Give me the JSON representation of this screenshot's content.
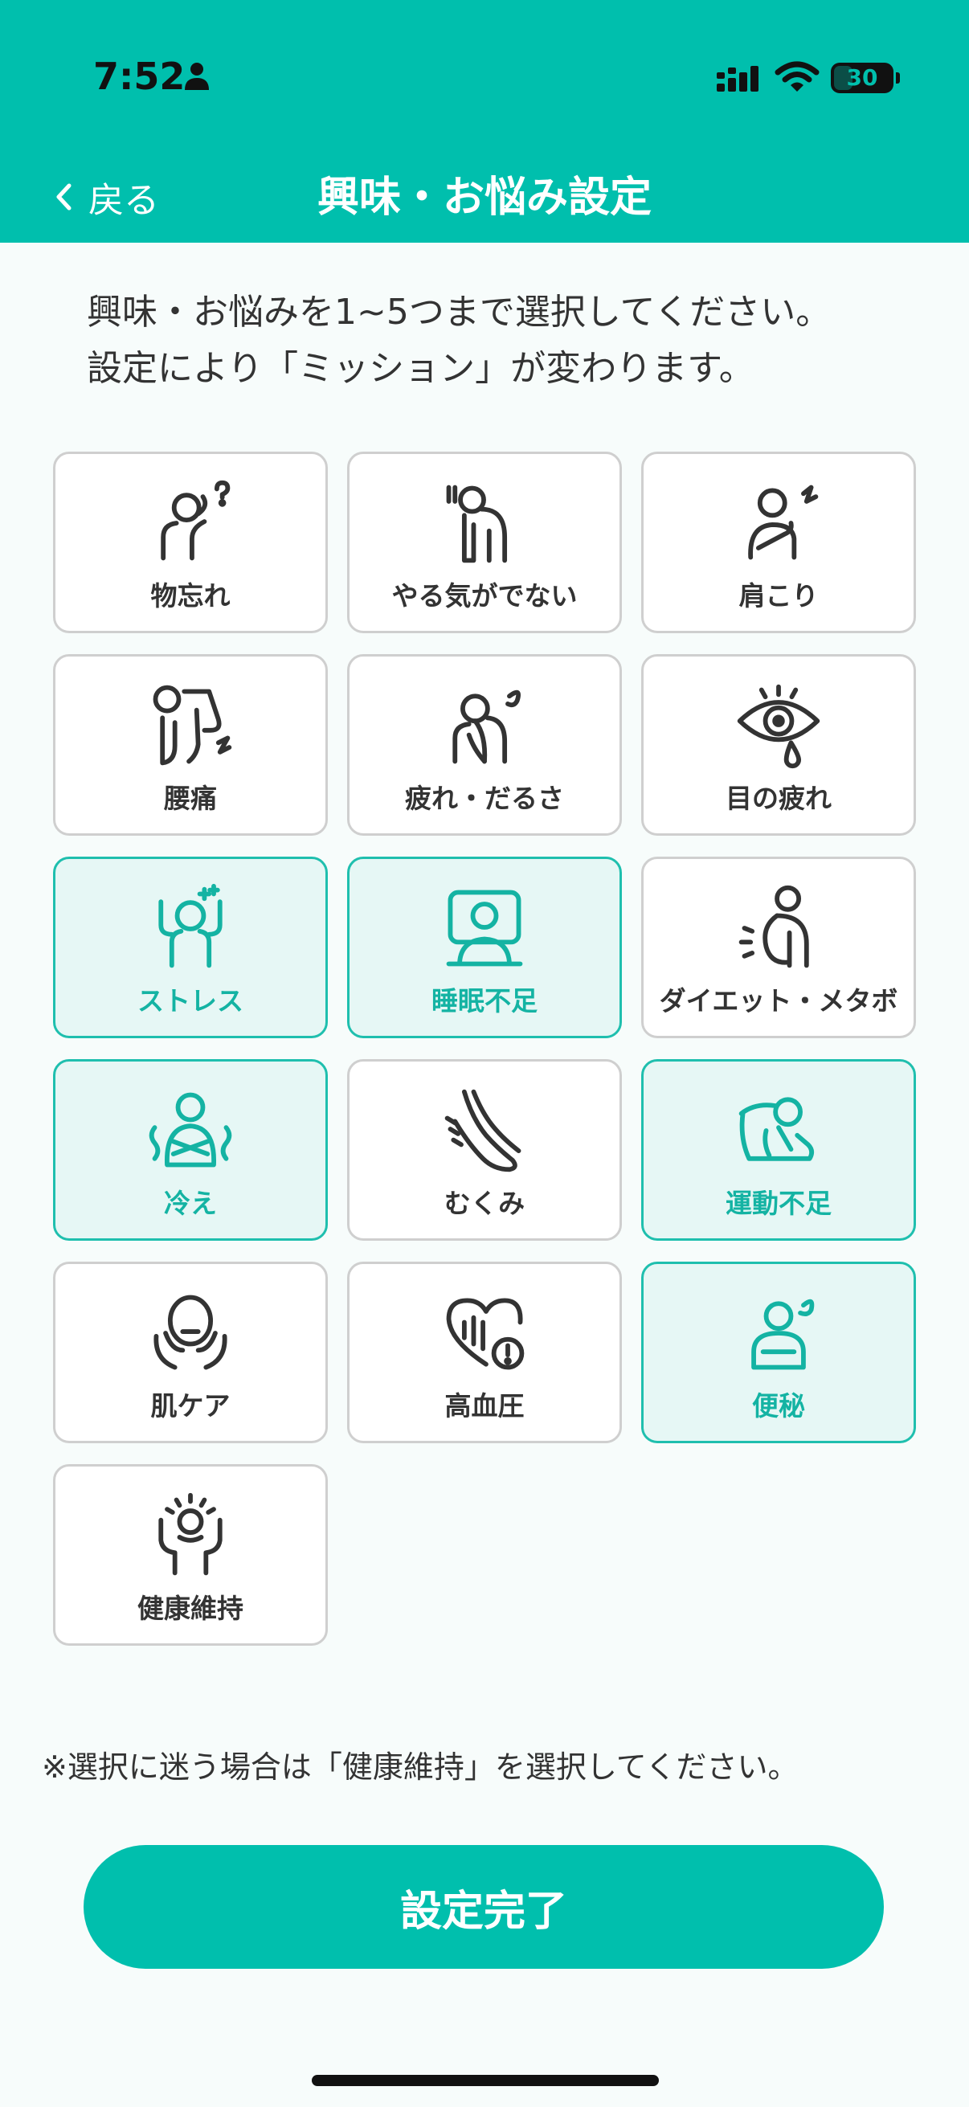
{
  "status_bar": {
    "time": "7:52",
    "battery_level": "30",
    "icons": [
      "person-icon",
      "signal-icon",
      "wifi-icon",
      "battery-icon"
    ]
  },
  "nav": {
    "back_label": "戻る",
    "title": "興味・お悩み設定"
  },
  "instructions": {
    "line1": "興味・お悩みを1~5つまで選択してください。",
    "line2": "設定により「ミッション」が変わります。"
  },
  "options": [
    {
      "label": "物忘れ",
      "icon": "forgetful-icon",
      "selected": false
    },
    {
      "label": "やる気がでない",
      "icon": "unmotivated-icon",
      "selected": false
    },
    {
      "label": "肩こり",
      "icon": "stiff-shoulder-icon",
      "selected": false
    },
    {
      "label": "腰痛",
      "icon": "back-pain-icon",
      "selected": false
    },
    {
      "label": "疲れ・だるさ",
      "icon": "fatigue-icon",
      "selected": false
    },
    {
      "label": "目の疲れ",
      "icon": "eye-strain-icon",
      "selected": false
    },
    {
      "label": "ストレス",
      "icon": "stress-icon",
      "selected": true
    },
    {
      "label": "睡眠不足",
      "icon": "sleep-icon",
      "selected": true
    },
    {
      "label": "ダイエット・メタボ",
      "icon": "diet-icon",
      "selected": false
    },
    {
      "label": "冷え",
      "icon": "cold-icon",
      "selected": true
    },
    {
      "label": "むくみ",
      "icon": "swelling-icon",
      "selected": false
    },
    {
      "label": "運動不足",
      "icon": "exercise-icon",
      "selected": true
    },
    {
      "label": "肌ケア",
      "icon": "skin-care-icon",
      "selected": false
    },
    {
      "label": "高血圧",
      "icon": "blood-pressure-icon",
      "selected": false
    },
    {
      "label": "便秘",
      "icon": "constipation-icon",
      "selected": true
    },
    {
      "label": "健康維持",
      "icon": "health-icon",
      "selected": false
    }
  ],
  "note": "※選択に迷う場合は「健康維持」を選択してください。",
  "done_label": "設定完了",
  "colors": {
    "accent": "#00bfad",
    "selected_bg": "#e6f7f5",
    "selected_text": "#14b3a3",
    "tile_border": "#cfcfcf"
  }
}
